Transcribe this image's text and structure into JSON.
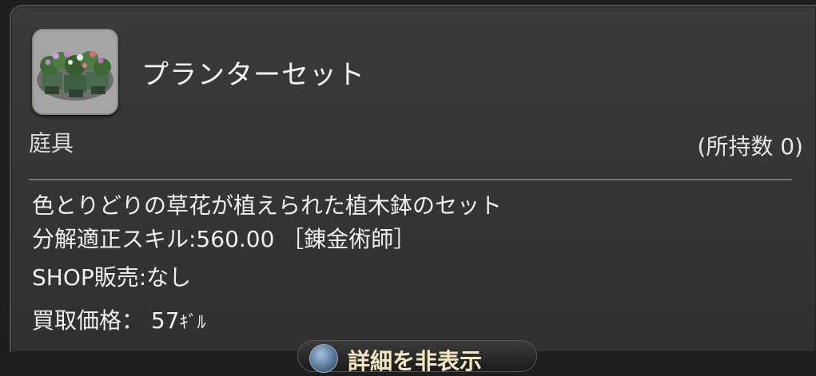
{
  "item": {
    "name": "プランターセット",
    "icon": "planter-set-icon",
    "category": "庭具",
    "owned": "(所持数 0)"
  },
  "description": {
    "flavor": "色とりどりの草花が植えられた植木鉢のセット",
    "desynth": "分解適正スキル:560.00 ［錬金術師］",
    "shop": "SHOP販売:なし",
    "sell_label": "買取価格：",
    "sell_value": "57",
    "gil_mark": "ｷﾞﾙ"
  },
  "footer": {
    "detail_label": "詳細を非表示"
  }
}
